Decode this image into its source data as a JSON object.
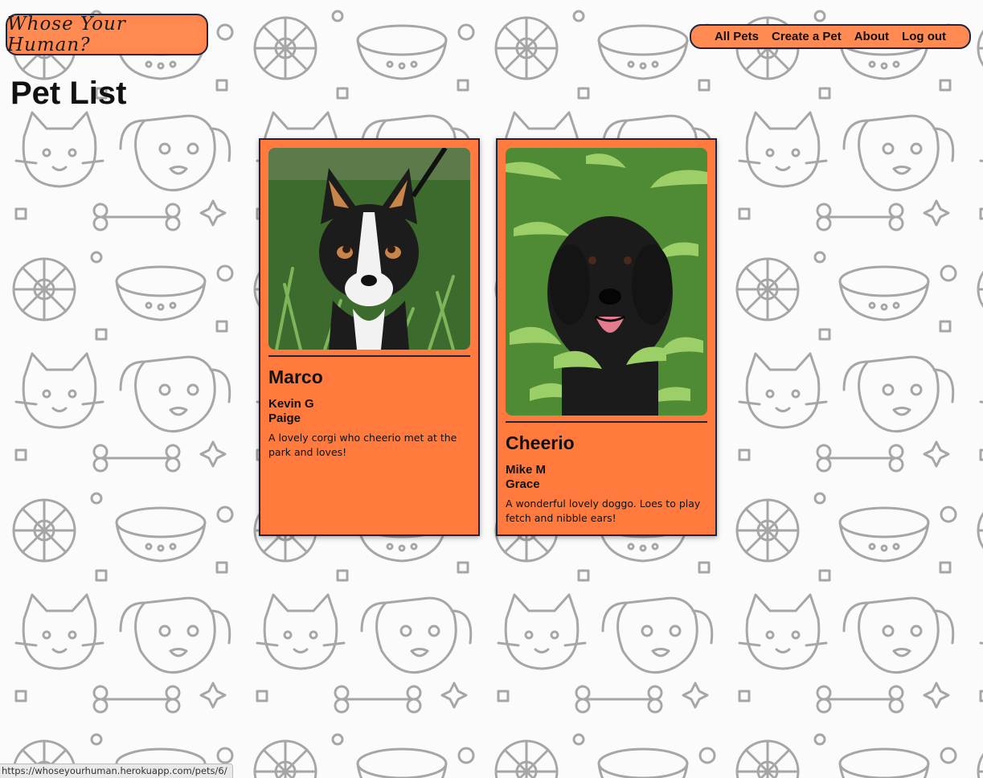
{
  "site": {
    "logo_text": "Whose Your Human?"
  },
  "nav": {
    "items": [
      {
        "label": "All Pets"
      },
      {
        "label": "Create a Pet"
      },
      {
        "label": "About"
      },
      {
        "label": "Log out"
      }
    ]
  },
  "page": {
    "title": "Pet List"
  },
  "pets": [
    {
      "name": "Marco",
      "owner": "Kevin G",
      "co_owner": "Paige",
      "description": "A lovely corgi who cheerio met at the park and loves!",
      "photo_icon": "corgi-photo"
    },
    {
      "name": "Cheerio",
      "owner": "Mike M",
      "co_owner": "Grace",
      "description": "A wonderful lovely doggo. Loes to play fetch and nibble ears!",
      "photo_icon": "black-doodle-photo"
    }
  ],
  "status_bar": {
    "url": "https://whoseyourhuman.herokuapp.com/pets/6/"
  },
  "colors": {
    "accent": "#ff7a3c",
    "accent_light": "#ff8a52",
    "border": "#1d2540"
  }
}
